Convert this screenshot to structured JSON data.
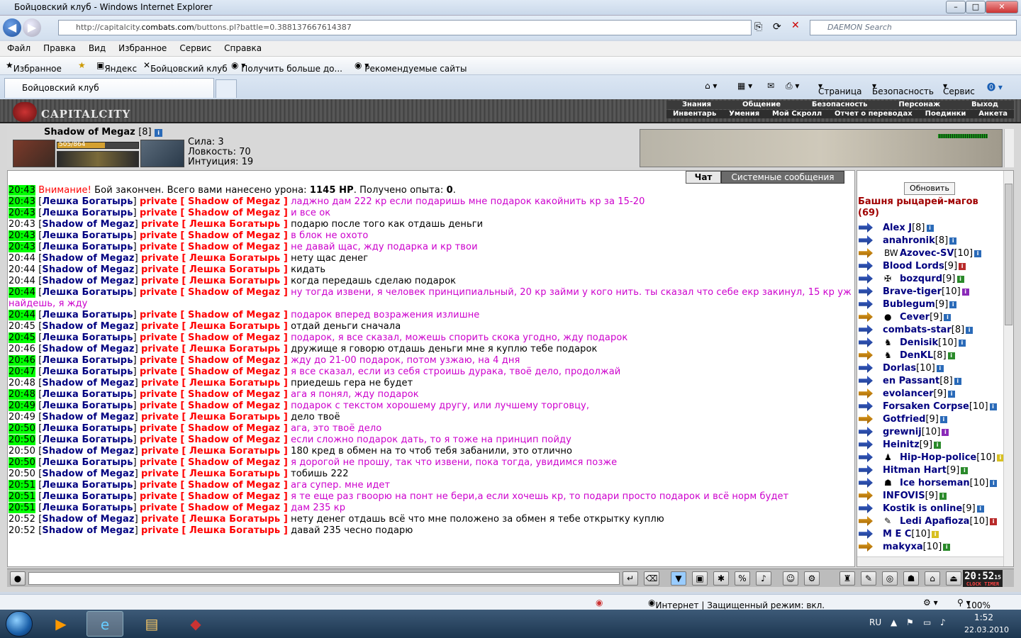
{
  "window": {
    "title": "Бойцовский клуб - Windows Internet Explorer",
    "controls": [
      "–",
      "□",
      "✕"
    ]
  },
  "address": {
    "url_prefix": "http://capitalcity.",
    "url_domain": "combats.com",
    "url_rest": "/buttons.pl?battle=0.388137667614387",
    "search_placeholder": "DAEMON Search"
  },
  "menu": [
    "Файл",
    "Правка",
    "Вид",
    "Избранное",
    "Сервис",
    "Справка"
  ],
  "favorites": {
    "label": "Избранное",
    "links": [
      "Яндекс",
      "Бойцовский клуб",
      "Получить больше до...",
      "Рекомендуемые сайты"
    ]
  },
  "tab": {
    "title": "Бойцовский клуб"
  },
  "commands": [
    "Страница",
    "Безопасность",
    "Сервис"
  ],
  "game": {
    "logo": "CAPITALCITY",
    "nav_top": [
      "Знания",
      "Общение",
      "Безопасность",
      "Персонаж",
      "Выход"
    ],
    "nav_bottom": [
      "Инвентарь",
      "Умения",
      "Мой Скролл",
      "Отчет о переводах",
      "Поединки",
      "Анкета"
    ],
    "character": {
      "name": "Shadow of Megaz",
      "level": "[8]",
      "hp": "505/864",
      "hp_fraction": 0.584,
      "stats": [
        "Сила: 3",
        "Ловкость: 70",
        "Интуиция: 19"
      ]
    },
    "chat_tabs": [
      "Чат",
      "Системные сообщения"
    ],
    "system_message": {
      "time": "20:43",
      "warn": "Внимание!",
      "text1": " Бой закончен. Всего вами нанесено урона: ",
      "dmg": "1145 HP",
      "text2": ". Получено опыта: ",
      "exp": "0",
      "text3": "."
    },
    "messages": [
      {
        "time": "20:43",
        "hl": true,
        "from": "Лешка Богатырь",
        "to": "Shadow of Megaz",
        "text": "ладжно дам 222 кр если подаришь мне подарок какойнить кр за 15-20",
        "mine": false
      },
      {
        "time": "20:43",
        "hl": true,
        "from": "Лешка Богатырь",
        "to": "Shadow of Megaz",
        "text": "и все ок",
        "mine": false
      },
      {
        "time": "20:43",
        "hl": false,
        "from": "Shadow of Megaz",
        "to": "Лешка Богатырь",
        "text": "подарю после того как отдашь деньги",
        "mine": true
      },
      {
        "time": "20:43",
        "hl": true,
        "from": "Лешка Богатырь",
        "to": "Shadow of Megaz",
        "text": "в блок не охото",
        "mine": false
      },
      {
        "time": "20:43",
        "hl": true,
        "from": "Лешка Богатырь",
        "to": "Shadow of Megaz",
        "text": "не давай щас, жду подарка и кр твои",
        "mine": false
      },
      {
        "time": "20:44",
        "hl": false,
        "from": "Shadow of Megaz",
        "to": "Лешка Богатырь",
        "text": "нету щас денег",
        "mine": true
      },
      {
        "time": "20:44",
        "hl": false,
        "from": "Shadow of Megaz",
        "to": "Лешка Богатырь",
        "text": "кидать",
        "mine": true
      },
      {
        "time": "20:44",
        "hl": false,
        "from": "Shadow of Megaz",
        "to": "Лешка Богатырь",
        "text": "когда передашь сделаю подарок",
        "mine": true
      },
      {
        "time": "20:44",
        "hl": true,
        "from": "Лешка Богатырь",
        "to": "Shadow of Megaz",
        "text": "ну тогда извени, я человек принципиальный, 20 кр займи у кого нить. ты сказал что себе екр закинул, 15 кр уж",
        "cont": "найдешь, я жду",
        "mine": false
      },
      {
        "time": "20:44",
        "hl": true,
        "from": "Лешка Богатырь",
        "to": "Shadow of Megaz",
        "text": "подарок вперед возражения излишне",
        "mine": false
      },
      {
        "time": "20:45",
        "hl": false,
        "from": "Shadow of Megaz",
        "to": "Лешка Богатырь",
        "text": "отдай деньги сначала",
        "mine": true
      },
      {
        "time": "20:45",
        "hl": true,
        "from": "Лешка Богатырь",
        "to": "Shadow of Megaz",
        "text": "подарок, я все сказал, можешь спорить скока угодно, жду подарок",
        "mine": false
      },
      {
        "time": "20:46",
        "hl": false,
        "from": "Shadow of Megaz",
        "to": "Лешка Богатырь",
        "text": "дружище я говорю отдашь деньги мне я куплю тебе подарок",
        "mine": true
      },
      {
        "time": "20:46",
        "hl": true,
        "from": "Лешка Богатырь",
        "to": "Shadow of Megaz",
        "text": "жду до 21-00 подарок, потом узжаю, на 4 дня",
        "mine": false
      },
      {
        "time": "20:47",
        "hl": true,
        "from": "Лешка Богатырь",
        "to": "Shadow of Megaz",
        "text": "я все сказал, если из себя строишь дурака, твоё дело, продолжай",
        "mine": false
      },
      {
        "time": "20:48",
        "hl": false,
        "from": "Shadow of Megaz",
        "to": "Лешка Богатырь",
        "text": "приедешь гера не будет",
        "mine": true
      },
      {
        "time": "20:48",
        "hl": true,
        "from": "Лешка Богатырь",
        "to": "Shadow of Megaz",
        "text": "ага я понял, жду подарок",
        "mine": false
      },
      {
        "time": "20:49",
        "hl": true,
        "from": "Лешка Богатырь",
        "to": "Shadow of Megaz",
        "text": "подарок с текстом хорошему другу, или лучшему торговцу,",
        "mine": false
      },
      {
        "time": "20:49",
        "hl": false,
        "from": "Shadow of Megaz",
        "to": "Лешка Богатырь",
        "text": "дело твоё",
        "mine": true
      },
      {
        "time": "20:50",
        "hl": true,
        "from": "Лешка Богатырь",
        "to": "Shadow of Megaz",
        "text": "ага, это твоё дело",
        "mine": false
      },
      {
        "time": "20:50",
        "hl": true,
        "from": "Лешка Богатырь",
        "to": "Shadow of Megaz",
        "text": "если сложно подарок дать, то я тоже на принцип пойду",
        "mine": false
      },
      {
        "time": "20:50",
        "hl": false,
        "from": "Shadow of Megaz",
        "to": "Лешка Богатырь",
        "text": "180 кред в обмен на то чтоб тебя забанили, это отлично",
        "mine": true
      },
      {
        "time": "20:50",
        "hl": true,
        "from": "Лешка Богатырь",
        "to": "Shadow of Megaz",
        "text": "я дорогой не прошу, так что извени, пока тогда, увидимся позже",
        "mine": false
      },
      {
        "time": "20:50",
        "hl": false,
        "from": "Shadow of Megaz",
        "to": "Лешка Богатырь",
        "text": "тобишь 222",
        "mine": true
      },
      {
        "time": "20:51",
        "hl": true,
        "from": "Лешка Богатырь",
        "to": "Shadow of Megaz",
        "text": "ага супер. мне идет",
        "mine": false
      },
      {
        "time": "20:51",
        "hl": true,
        "from": "Лешка Богатырь",
        "to": "Shadow of Megaz",
        "text": "я те еще раз гвоорю на понт не бери,а если хочешь кр, то подари просто подарок и всё норм будет",
        "mine": false
      },
      {
        "time": "20:51",
        "hl": true,
        "from": "Лешка Богатырь",
        "to": "Shadow of Megaz",
        "text": "дам 235 кр",
        "mine": false
      },
      {
        "time": "20:52",
        "hl": false,
        "from": "Shadow of Megaz",
        "to": "Лешка Богатырь",
        "text": "нету денег отдашь всё что мне положено за обмен я тебе открытку куплю",
        "mine": true
      },
      {
        "time": "20:52",
        "hl": false,
        "from": "Shadow of Megaz",
        "to": "Лешка Богатырь",
        "text": "давай 235 чесно подарю",
        "mine": true
      }
    ],
    "private_label": "private",
    "sidebar": {
      "refresh": "Обновить",
      "room_line1": "Башня рыцарей-магов",
      "room_line2": "(69)",
      "users": [
        {
          "name": "Alex J",
          "lv": "[8]",
          "inf": "b",
          "y": false,
          "emb": ""
        },
        {
          "name": "anahronik",
          "lv": "[8]",
          "inf": "b",
          "y": false,
          "emb": ""
        },
        {
          "name": "Azovec-SV",
          "lv": "[10]",
          "inf": "b",
          "y": true,
          "emb": "BW"
        },
        {
          "name": "Blood Lords",
          "lv": "[9]",
          "inf": "rd",
          "y": false,
          "emb": ""
        },
        {
          "name": "bozqurd",
          "lv": "[9]",
          "inf": "gr",
          "y": false,
          "emb": "✠"
        },
        {
          "name": "Brave-tiger",
          "lv": "[10]",
          "inf": "pp",
          "y": false,
          "emb": ""
        },
        {
          "name": "Bublegum",
          "lv": "[9]",
          "inf": "b",
          "y": false,
          "emb": ""
        },
        {
          "name": "Cever",
          "lv": "[9]",
          "inf": "b",
          "y": true,
          "emb": "●"
        },
        {
          "name": "combats-star",
          "lv": "[8]",
          "inf": "b",
          "y": false,
          "emb": ""
        },
        {
          "name": "Denisik",
          "lv": "[10]",
          "inf": "b",
          "y": false,
          "emb": "♞"
        },
        {
          "name": "DenKL",
          "lv": "[8]",
          "inf": "gr",
          "y": true,
          "emb": "♞"
        },
        {
          "name": "Dorlas",
          "lv": "[10]",
          "inf": "b",
          "y": false,
          "emb": ""
        },
        {
          "name": "en Passant",
          "lv": "[8]",
          "inf": "b",
          "y": false,
          "emb": ""
        },
        {
          "name": "evolancer",
          "lv": "[9]",
          "inf": "b",
          "y": true,
          "emb": ""
        },
        {
          "name": "Forsaken Corpse",
          "lv": "[10]",
          "inf": "b",
          "y": false,
          "emb": ""
        },
        {
          "name": "Gotfried",
          "lv": "[9]",
          "inf": "b",
          "y": true,
          "emb": ""
        },
        {
          "name": "grewnij",
          "lv": "[10]",
          "inf": "pp",
          "y": false,
          "emb": ""
        },
        {
          "name": "Heinitz",
          "lv": "[9]",
          "inf": "gr",
          "y": false,
          "emb": ""
        },
        {
          "name": "Hip-Hop-police",
          "lv": "[10]",
          "inf": "yl",
          "y": false,
          "emb": "♟"
        },
        {
          "name": "Hitman Hart",
          "lv": "[9]",
          "inf": "gr",
          "y": false,
          "emb": ""
        },
        {
          "name": "Ice horseman",
          "lv": "[10]",
          "inf": "b",
          "y": false,
          "emb": "☗"
        },
        {
          "name": "INFOVIS",
          "lv": "[9]",
          "inf": "gr",
          "y": true,
          "emb": ""
        },
        {
          "name": "Kostik is online",
          "lv": "[9]",
          "inf": "b",
          "y": false,
          "emb": ""
        },
        {
          "name": "Ledi Apafioza",
          "lv": "[10]",
          "inf": "rd",
          "y": true,
          "emb": "✎"
        },
        {
          "name": "M E C",
          "lv": "[10]",
          "inf": "yl",
          "y": false,
          "emb": ""
        },
        {
          "name": "makyxa",
          "lv": "[10]",
          "inf": "gr",
          "y": true,
          "emb": ""
        }
      ]
    },
    "clock": {
      "time": "20:52",
      "sec": "15",
      "label": "CLOCK TIMER"
    }
  },
  "statusbar": {
    "zone": "Интернет | Защищенный режим: вкл.",
    "zoom": "100%"
  },
  "taskbar": {
    "lang": "RU",
    "time": "1:52",
    "date": "22.03.2010"
  }
}
